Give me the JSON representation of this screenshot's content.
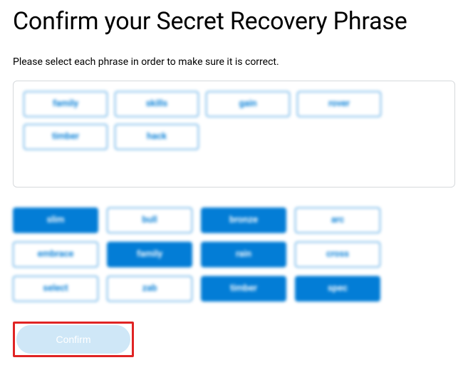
{
  "title": "Confirm your Secret Recovery Phrase",
  "subtitle": "Please select each phrase in order to make sure it is correct.",
  "selected_area": {
    "chips": [
      "family",
      "skills",
      "gain",
      "rover",
      "timber",
      "hack"
    ]
  },
  "word_bank": [
    {
      "label": "slim",
      "selected": true
    },
    {
      "label": "bull",
      "selected": false
    },
    {
      "label": "bronze",
      "selected": true
    },
    {
      "label": "arc",
      "selected": false
    },
    {
      "label": "embrace",
      "selected": false
    },
    {
      "label": "family",
      "selected": true
    },
    {
      "label": "rain",
      "selected": true
    },
    {
      "label": "cross",
      "selected": false
    },
    {
      "label": "select",
      "selected": false
    },
    {
      "label": "zab",
      "selected": false
    },
    {
      "label": "timber",
      "selected": true
    },
    {
      "label": "spec",
      "selected": true
    }
  ],
  "confirm_label": "Confirm",
  "colors": {
    "accent": "#037dd6",
    "confirm_disabled_bg": "#cde6f7",
    "highlight_border": "#e02424"
  }
}
